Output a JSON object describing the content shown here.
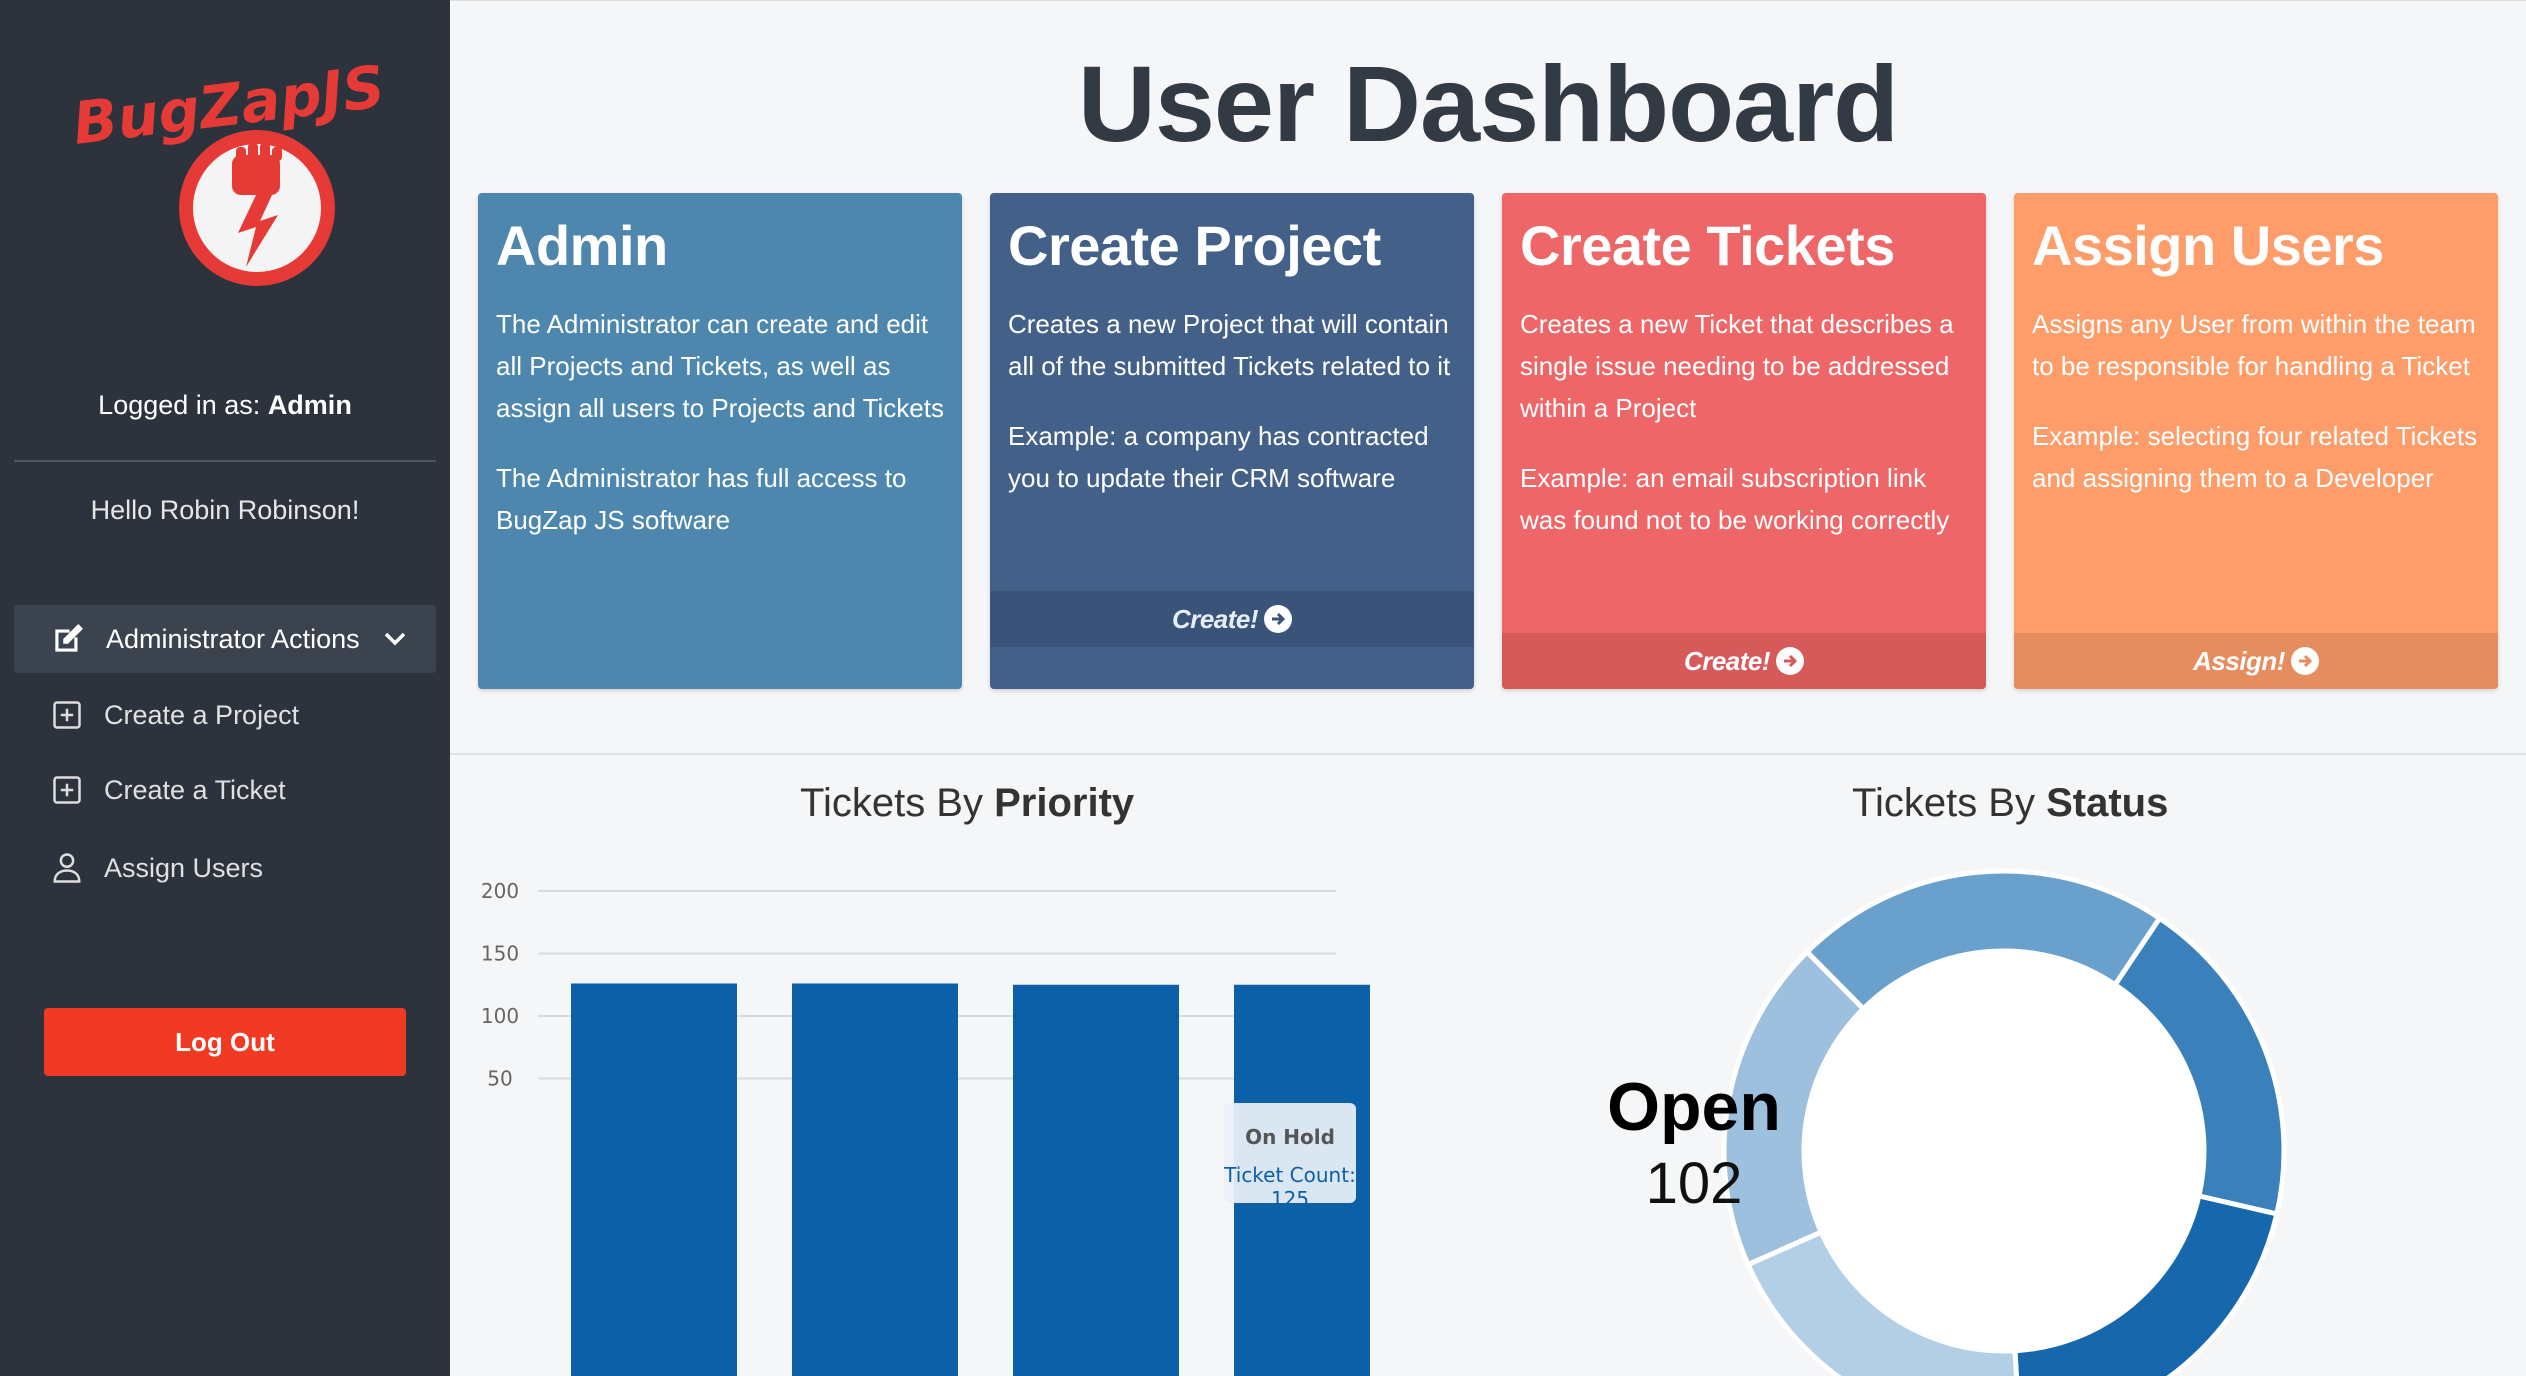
{
  "sidebar": {
    "logo_text": "BugZapJS",
    "logged_in_prefix": "Logged in as: ",
    "logged_in_role": "Admin",
    "greeting": "Hello Robin Robinson!",
    "nav": {
      "admin_actions": "Administrator Actions",
      "create_project": "Create a Project",
      "create_ticket": "Create a Ticket",
      "assign_users": "Assign Users"
    },
    "logout_label": "Log Out"
  },
  "main": {
    "title": "User Dashboard",
    "cards": {
      "admin": {
        "title": "Admin",
        "p1": "The Administrator can create and edit all Projects and Tickets, as well as assign all users to Projects and Tickets",
        "p2": "The Administrator has full access to BugZap JS software"
      },
      "project": {
        "title": "Create Project",
        "p1": "Creates a new Project that will contain all of the submitted Tickets related to it",
        "p2": "Example: a company has contracted you to update their CRM software",
        "action": "Create!"
      },
      "tickets": {
        "title": "Create Tickets",
        "p1": "Creates a new Ticket that describes a single issue needing to be addressed within a Project",
        "p2": "Example: an email subscription link was found not to be working correctly",
        "action": "Create!"
      },
      "assign": {
        "title": "Assign Users",
        "p1": "Assigns any User from within the team to be responsible for handling a Ticket",
        "p2": "Example: selecting four related Tickets and assigning them to a Developer",
        "action": "Assign!"
      }
    },
    "priority_title": {
      "prefix": "Tickets By ",
      "bold": "Priority"
    },
    "status_title": {
      "prefix": "Tickets By ",
      "bold": "Status"
    },
    "tooltip": {
      "label": "On Hold",
      "value": "Ticket Count: 125"
    },
    "donut_center": {
      "label": "Open",
      "value": "102"
    }
  },
  "chart_data": [
    {
      "type": "bar",
      "title": "Tickets By Priority",
      "categories": [
        "",
        "",
        "",
        "On Hold"
      ],
      "values": [
        126,
        126,
        125,
        125
      ],
      "ylim": [
        0,
        200
      ],
      "yticks": [
        50,
        100,
        150,
        200
      ],
      "grid": true,
      "bar_color": "#0c60a7",
      "grid_color": "#d8dadd"
    },
    {
      "type": "pie",
      "subtype": "donut",
      "title": "Tickets By Status",
      "center_label": "Open",
      "center_value": 102,
      "slices": [
        {
          "value": 102,
          "color": "#6aa0cc"
        },
        {
          "value": 90,
          "color": "#3a80bb"
        },
        {
          "value": 96,
          "color": "#1667ab"
        },
        {
          "value": 90,
          "color": "#b3cfe6"
        },
        {
          "value": 90,
          "color": "#9dc0de"
        }
      ]
    }
  ]
}
